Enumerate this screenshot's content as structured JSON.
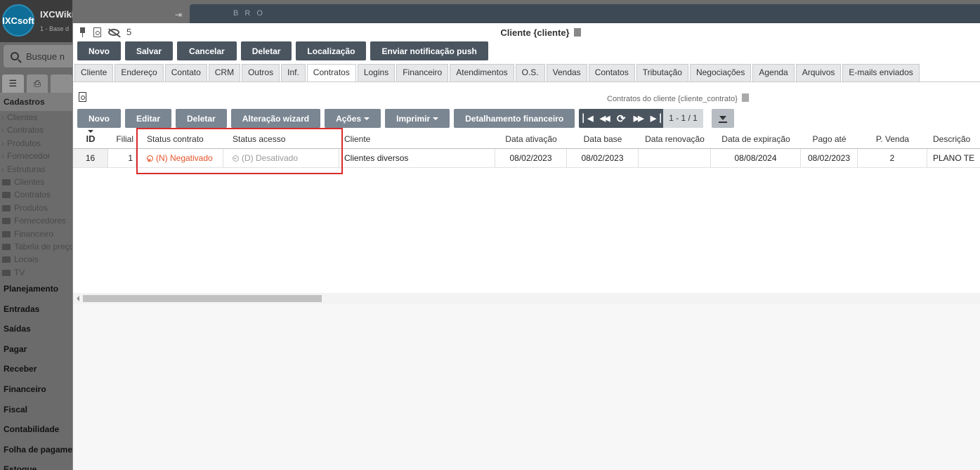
{
  "app": {
    "name": "IXCWiki",
    "logo_text": "IXCsoft",
    "subtitle": "1 - Base d",
    "search_placeholder": "Busque n"
  },
  "background_window": {
    "title": "B R O"
  },
  "sidebar": {
    "tabs": [
      "list-icon",
      "print-icon",
      ""
    ],
    "section_header": "Cadastros",
    "items": [
      "Clientes",
      "Contratos",
      "Produtos",
      "Fornecedor",
      "Estruturas"
    ],
    "folders": [
      "Clientes",
      "Contratos",
      "Produtos",
      "Fornecedores",
      "Financeiro",
      "Tabela de preço",
      "Locais",
      "TV"
    ],
    "sections": [
      "Planejamento",
      "Entradas",
      "Saídas",
      "Pagar",
      "Receber",
      "Financeiro",
      "Fiscal",
      "Contabilidade",
      "Folha de pagame",
      "Estoque"
    ]
  },
  "window": {
    "title": "Cliente {cliente}",
    "watch_count": "5",
    "toolbar": [
      "Novo",
      "Salvar",
      "Cancelar",
      "Deletar",
      "Localização",
      "Enviar notificação push"
    ],
    "tabs": [
      "Cliente",
      "Endereço",
      "Contato",
      "CRM",
      "Outros",
      "Inf.",
      "Contratos",
      "Logins",
      "Financeiro",
      "Atendimentos",
      "O.S.",
      "Vendas",
      "Contatos",
      "Tributação",
      "Negociações",
      "Agenda",
      "Arquivos",
      "E-mails enviados"
    ],
    "active_tab": "Contratos"
  },
  "contracts": {
    "title": "Contratos do cliente {cliente_contrato}",
    "toolbar": {
      "novo": "Novo",
      "editar": "Editar",
      "deletar": "Deletar",
      "alteracao": "Alteração wizard",
      "acoes": "Ações",
      "imprimir": "Imprimir",
      "detalhamento": "Detalhamento financeiro"
    },
    "pager": {
      "info": "1 - 1 / 1"
    },
    "columns": [
      "ID",
      "Filial",
      "Status contrato",
      "Status acesso",
      "Cliente",
      "Data ativação",
      "Data base",
      "Data renovação",
      "Data de expiração",
      "Pago até",
      "P. Venda",
      "Descrição"
    ],
    "rows": [
      {
        "id": "16",
        "filial": "1",
        "status_contrato": "(N) Negativado",
        "status_acesso": "(D) Desativado",
        "cliente": "Clientes diversos",
        "data_ativacao": "08/02/2023",
        "data_base": "08/02/2023",
        "data_renovacao": "",
        "data_expiracao": "08/08/2024",
        "pago_ate": "08/02/2023",
        "p_venda": "2",
        "descricao": "PLANO TE"
      }
    ]
  },
  "colors": {
    "button": "#4a5560",
    "negativado": "#e5542a",
    "desativado": "#999999",
    "highlight": "#d92a2a"
  }
}
